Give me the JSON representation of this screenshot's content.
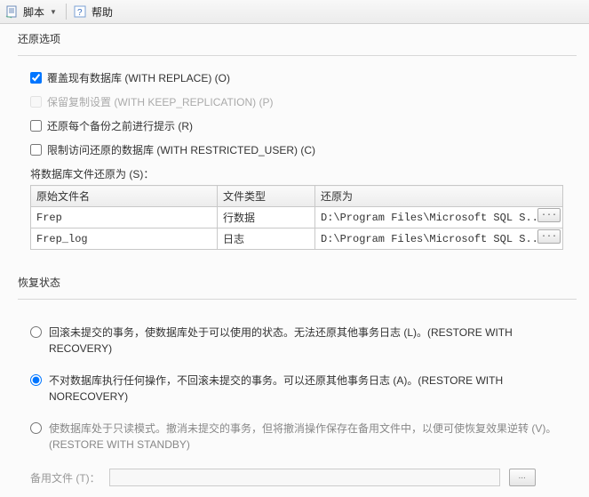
{
  "toolbar": {
    "script_label": "脚本",
    "help_label": "帮助"
  },
  "restore_options": {
    "title": "还原选项",
    "cb_overwrite": "覆盖现有数据库 (WITH REPLACE) (O)",
    "cb_keep_replication": "保留复制设置 (WITH KEEP_REPLICATION) (P)",
    "cb_prompt_each": "还原每个备份之前进行提示 (R)",
    "cb_restricted": "限制访问还原的数据库 (WITH RESTRICTED_USER) (C)",
    "files_label": "将数据库文件还原为 (S)："
  },
  "file_table": {
    "col_orig": "原始文件名",
    "col_type": "文件类型",
    "col_restore": "还原为",
    "rows": [
      {
        "orig": "Frep",
        "type": "行数据",
        "restore": "D:\\Program Files\\Microsoft SQL S..."
      },
      {
        "orig": "Frep_log",
        "type": "日志",
        "restore": "D:\\Program Files\\Microsoft SQL S..."
      }
    ],
    "browse_btn": "..."
  },
  "recovery_state": {
    "title": "恢复状态",
    "opt_recovery": "回滚未提交的事务，使数据库处于可以使用的状态。无法还原其他事务日志 (L)。(RESTORE WITH RECOVERY)",
    "opt_norecovery": "不对数据库执行任何操作，不回滚未提交的事务。可以还原其他事务日志 (A)。(RESTORE WITH NORECOVERY)",
    "opt_standby": "使数据库处于只读模式。撤消未提交的事务，但将撤消操作保存在备用文件中，以便可使恢复效果逆转 (V)。(RESTORE WITH STANDBY)",
    "standby_file_label": "备用文件 (T)："
  }
}
